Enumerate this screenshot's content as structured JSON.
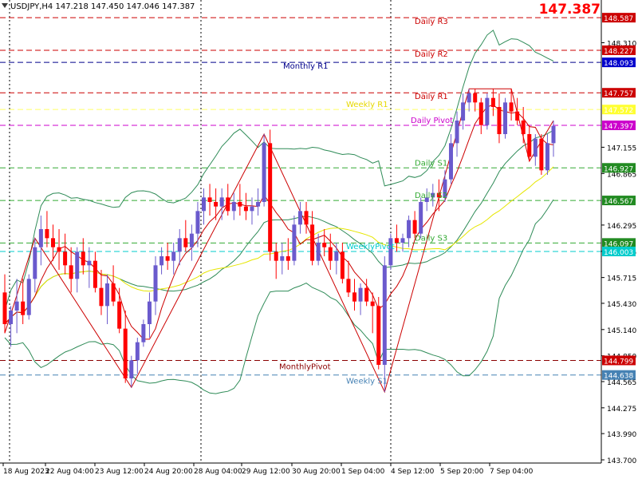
{
  "header": {
    "symbol_info": "USDJPY,H4  147.218 147.450 147.046 147.387",
    "current_price": "147.387"
  },
  "colors": {
    "bull": "#6a5acd",
    "bear": "#ff0000",
    "bb_band": "#2e8b57",
    "ma_fast": "#cc0000",
    "ma_slow": "#e6e600",
    "zigzag": "#cc0000",
    "grid": "#000000"
  },
  "chart_data": {
    "type": "candlestick",
    "symbol": "USDJPY",
    "timeframe": "H4",
    "ylim": [
      143.7,
      148.65
    ],
    "y_ticks": [
      "148.310",
      "147.155",
      "146.865",
      "146.295",
      "146.005",
      "145.715",
      "145.430",
      "145.140",
      "144.850",
      "144.565",
      "144.275",
      "143.990",
      "143.700"
    ],
    "y_tick_values": [
      148.31,
      147.155,
      146.865,
      146.295,
      146.005,
      145.715,
      145.43,
      145.14,
      144.85,
      144.565,
      144.275,
      143.99,
      143.7
    ],
    "x_ticks": [
      "18 Aug 2023",
      "22 Aug 04:00",
      "23 Aug 12:00",
      "24 Aug 20:00",
      "28 Aug 04:00",
      "29 Aug 12:00",
      "30 Aug 20:00",
      "1 Sep 04:00",
      "4 Sep 12:00",
      "5 Sep 20:00",
      "7 Sep 04:00"
    ],
    "x_tick_positions": [
      4,
      57,
      119,
      181,
      243,
      303,
      366,
      428,
      490,
      552,
      614
    ],
    "day_separators": [
      12,
      252,
      490
    ],
    "levels": [
      {
        "label": "Daily R3",
        "price": 148.587,
        "price_label": "148.587",
        "color": "#cc0000",
        "badge": "#cc0000"
      },
      {
        "label": "Daily R2",
        "price": 148.227,
        "price_label": "148.227",
        "color": "#cc0000",
        "badge": "#cc0000"
      },
      {
        "label": "Monthly R1",
        "price": 148.093,
        "price_label": "148.093",
        "color": "#00008b",
        "badge": "#0000cc"
      },
      {
        "label": "Daily R1",
        "price": 147.757,
        "price_label": "147.757",
        "color": "#cc0000",
        "badge": "#cc0000"
      },
      {
        "label": "Weekly R1",
        "price": 147.572,
        "price_label": "147.572",
        "color": "#ffff66",
        "badge": "#ffff33"
      },
      {
        "label": "Daily Pivot",
        "price": 147.397,
        "price_label": "147.397",
        "color": "#cc00cc",
        "badge": "#cc00cc"
      },
      {
        "label": "Daily S1",
        "price": 146.927,
        "price_label": "146.927",
        "color": "#33aa33",
        "badge": "#228b22"
      },
      {
        "label": "Daily S2",
        "price": 146.567,
        "price_label": "146.567",
        "color": "#33aa33",
        "badge": "#228b22"
      },
      {
        "label": "Daily S3",
        "price": 146.097,
        "price_label": "146.097",
        "color": "#33aa33",
        "badge": "#228b22"
      },
      {
        "label": "WeeklyPivot",
        "price": 146.003,
        "price_label": "146.003",
        "color": "#00cccc",
        "badge": "#00cccc"
      },
      {
        "label": "MonthlyPivot",
        "price": 144.799,
        "price_label": "144.799",
        "color": "#8b0000",
        "badge": "#cc0000"
      },
      {
        "label": "Weekly S1",
        "price": 144.638,
        "price_label": "144.638",
        "color": "#4682b4",
        "badge": "#4682b4"
      }
    ],
    "candles": [
      [
        145.55,
        145.75,
        145.1,
        145.2
      ],
      [
        145.2,
        145.4,
        144.95,
        145.35
      ],
      [
        145.35,
        145.7,
        145.1,
        145.45
      ],
      [
        145.45,
        145.7,
        145.2,
        145.3
      ],
      [
        145.3,
        145.75,
        145.25,
        145.7
      ],
      [
        145.7,
        146.15,
        145.55,
        146.05
      ],
      [
        146.05,
        146.4,
        145.85,
        146.25
      ],
      [
        146.25,
        146.45,
        146.05,
        146.15
      ],
      [
        146.15,
        146.3,
        145.9,
        146.05
      ],
      [
        146.05,
        146.25,
        145.8,
        146.0
      ],
      [
        146.0,
        146.2,
        145.75,
        145.85
      ],
      [
        145.85,
        146.05,
        145.55,
        145.7
      ],
      [
        145.7,
        146.05,
        145.55,
        146.0
      ],
      [
        146.0,
        146.15,
        145.75,
        145.85
      ],
      [
        145.85,
        146.05,
        145.6,
        145.9
      ],
      [
        145.9,
        146.0,
        145.55,
        145.6
      ],
      [
        145.6,
        145.8,
        145.3,
        145.4
      ],
      [
        145.4,
        145.75,
        145.2,
        145.65
      ],
      [
        145.65,
        145.85,
        145.4,
        145.45
      ],
      [
        145.45,
        145.6,
        145.1,
        145.15
      ],
      [
        145.15,
        145.35,
        144.55,
        144.6
      ],
      [
        144.6,
        144.85,
        144.5,
        144.8
      ],
      [
        144.8,
        145.05,
        144.65,
        145.0
      ],
      [
        145.0,
        145.25,
        144.95,
        145.2
      ],
      [
        145.2,
        145.55,
        145.05,
        145.45
      ],
      [
        145.45,
        145.95,
        145.3,
        145.85
      ],
      [
        145.85,
        146.05,
        145.75,
        145.95
      ],
      [
        145.95,
        146.1,
        145.8,
        145.9
      ],
      [
        145.9,
        146.1,
        145.75,
        146.0
      ],
      [
        146.0,
        146.25,
        145.85,
        146.15
      ],
      [
        146.15,
        146.35,
        146.0,
        146.05
      ],
      [
        146.05,
        146.3,
        145.9,
        146.2
      ],
      [
        146.2,
        146.55,
        146.05,
        146.45
      ],
      [
        146.45,
        146.7,
        146.3,
        146.6
      ],
      [
        146.6,
        146.75,
        146.4,
        146.55
      ],
      [
        146.55,
        146.7,
        146.35,
        146.5
      ],
      [
        146.5,
        146.7,
        146.35,
        146.6
      ],
      [
        146.6,
        146.75,
        146.4,
        146.45
      ],
      [
        146.45,
        146.65,
        146.35,
        146.55
      ],
      [
        146.55,
        146.75,
        146.4,
        146.5
      ],
      [
        146.5,
        146.65,
        146.35,
        146.45
      ],
      [
        146.45,
        146.6,
        146.3,
        146.5
      ],
      [
        146.5,
        146.7,
        146.4,
        146.55
      ],
      [
        146.55,
        147.3,
        146.5,
        147.2
      ],
      [
        147.2,
        147.35,
        145.9,
        146.0
      ],
      [
        146.0,
        146.1,
        145.7,
        145.9
      ],
      [
        145.9,
        146.1,
        145.75,
        145.95
      ],
      [
        145.95,
        146.15,
        145.8,
        145.9
      ],
      [
        145.9,
        146.4,
        145.85,
        146.3
      ],
      [
        146.3,
        146.55,
        146.2,
        146.45
      ],
      [
        146.45,
        146.55,
        146.2,
        146.3
      ],
      [
        146.3,
        146.45,
        145.85,
        145.9
      ],
      [
        145.9,
        146.2,
        145.85,
        146.1
      ],
      [
        146.1,
        146.25,
        145.95,
        146.05
      ],
      [
        146.05,
        146.2,
        145.8,
        145.9
      ],
      [
        145.9,
        146.1,
        145.75,
        146.0
      ],
      [
        146.0,
        146.1,
        145.65,
        145.7
      ],
      [
        145.7,
        145.9,
        145.5,
        145.55
      ],
      [
        145.55,
        145.7,
        145.35,
        145.45
      ],
      [
        145.45,
        145.65,
        145.3,
        145.6
      ],
      [
        145.6,
        145.7,
        145.4,
        145.45
      ],
      [
        145.45,
        145.55,
        145.1,
        145.4
      ],
      [
        145.4,
        145.5,
        144.7,
        144.75
      ],
      [
        144.75,
        145.95,
        144.45,
        145.85
      ],
      [
        145.85,
        146.2,
        145.8,
        146.15
      ],
      [
        146.15,
        146.3,
        146.0,
        146.1
      ],
      [
        146.1,
        146.2,
        146.0,
        146.15
      ],
      [
        146.15,
        146.4,
        146.05,
        146.35
      ],
      [
        146.35,
        146.45,
        146.15,
        146.2
      ],
      [
        146.2,
        146.6,
        146.15,
        146.55
      ],
      [
        146.55,
        146.7,
        146.45,
        146.6
      ],
      [
        146.6,
        146.75,
        146.5,
        146.65
      ],
      [
        146.65,
        146.8,
        146.45,
        146.6
      ],
      [
        146.6,
        146.9,
        146.55,
        146.8
      ],
      [
        146.8,
        147.3,
        146.75,
        147.2
      ],
      [
        147.2,
        147.55,
        147.05,
        147.45
      ],
      [
        147.45,
        147.75,
        147.35,
        147.65
      ],
      [
        147.65,
        147.8,
        147.55,
        147.75
      ],
      [
        147.75,
        147.8,
        147.55,
        147.65
      ],
      [
        147.65,
        147.7,
        147.3,
        147.4
      ],
      [
        147.4,
        147.75,
        147.35,
        147.7
      ],
      [
        147.7,
        147.8,
        147.5,
        147.6
      ],
      [
        147.6,
        147.75,
        147.2,
        147.3
      ],
      [
        147.3,
        147.7,
        147.25,
        147.65
      ],
      [
        147.65,
        147.8,
        147.45,
        147.55
      ],
      [
        147.55,
        147.7,
        147.4,
        147.45
      ],
      [
        147.45,
        147.6,
        147.2,
        147.3
      ],
      [
        147.3,
        147.4,
        147.0,
        147.05
      ],
      [
        147.05,
        147.3,
        146.95,
        147.25
      ],
      [
        147.25,
        147.3,
        146.85,
        146.9
      ],
      [
        146.9,
        147.3,
        146.85,
        147.2
      ],
      [
        147.2,
        147.45,
        147.05,
        147.39
      ]
    ]
  }
}
